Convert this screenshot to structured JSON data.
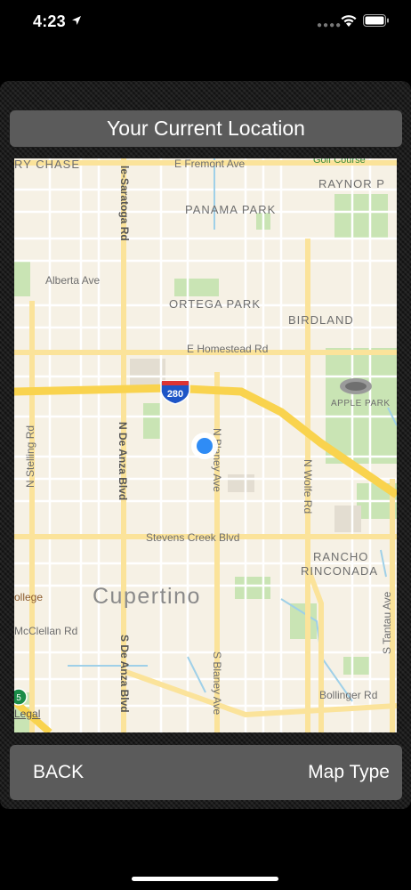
{
  "status_bar": {
    "time": "4:23"
  },
  "title": "Your Current Location",
  "map": {
    "legal": "Legal",
    "shield": "280",
    "shield_left": "5",
    "labels": {
      "ry_chase": "RY CHASE",
      "fremont": "E Fremont Ave",
      "golf": "Golf Course",
      "raynor": "RAYNOR P",
      "saratoga": "le-Saratoga Rd",
      "panama": "PANAMA PARK",
      "alberta": "Alberta Ave",
      "ortega": "ORTEGA PARK",
      "birdland": "BIRDLAND",
      "homestead": "E Homestead Rd",
      "apple_park": "APPLE PARK",
      "stelling": "N Stelling Rd",
      "n_de_anza": "N De Anza Blvd",
      "n_blaney": "N Blaney Ave",
      "n_wolfe": "N Wolfe Rd",
      "stevens": "Stevens Creek Blvd",
      "rancho": "RANCHO",
      "rinconada": "RINCONADA",
      "ollege": "ollege",
      "cupertino": "Cupertino",
      "s_tantau": "S Tantau Ave",
      "mcclellan": "McClellan Rd",
      "s_de_anza": "S De Anza Blvd",
      "s_blaney": "S Blaney Ave",
      "bollinger": "Bollinger Rd"
    }
  },
  "buttons": {
    "back": "BACK",
    "map_type": "Map Type"
  },
  "colors": {
    "button_bg": "#5b5b5b",
    "map_bg": "#f6f1e5",
    "highway": "#f9d34e",
    "location_dot": "#2f8cf5"
  }
}
